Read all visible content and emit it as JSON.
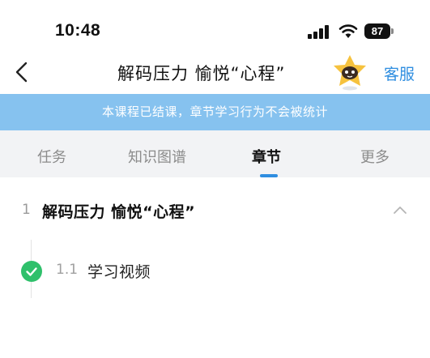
{
  "status": {
    "time": "10:48",
    "battery": "87"
  },
  "nav": {
    "title": "解码压力 愉悦“心程”",
    "service_label": "客服"
  },
  "notice": {
    "text": "本课程已结课，章节学习行为不会被统计"
  },
  "tabs": [
    {
      "label": "任务",
      "active": false
    },
    {
      "label": "知识图谱",
      "active": false
    },
    {
      "label": "章节",
      "active": true
    },
    {
      "label": "更多",
      "active": false
    }
  ],
  "chapter": {
    "number": "1",
    "title": "解码压力 愉悦“心程”",
    "sections": [
      {
        "number": "1.1",
        "title": "学习视频",
        "completed": true
      }
    ]
  },
  "colors": {
    "accent": "#2f8ee0",
    "banner": "#86c2ef",
    "complete": "#2fc06b",
    "tab_bg": "#f2f3f5"
  }
}
